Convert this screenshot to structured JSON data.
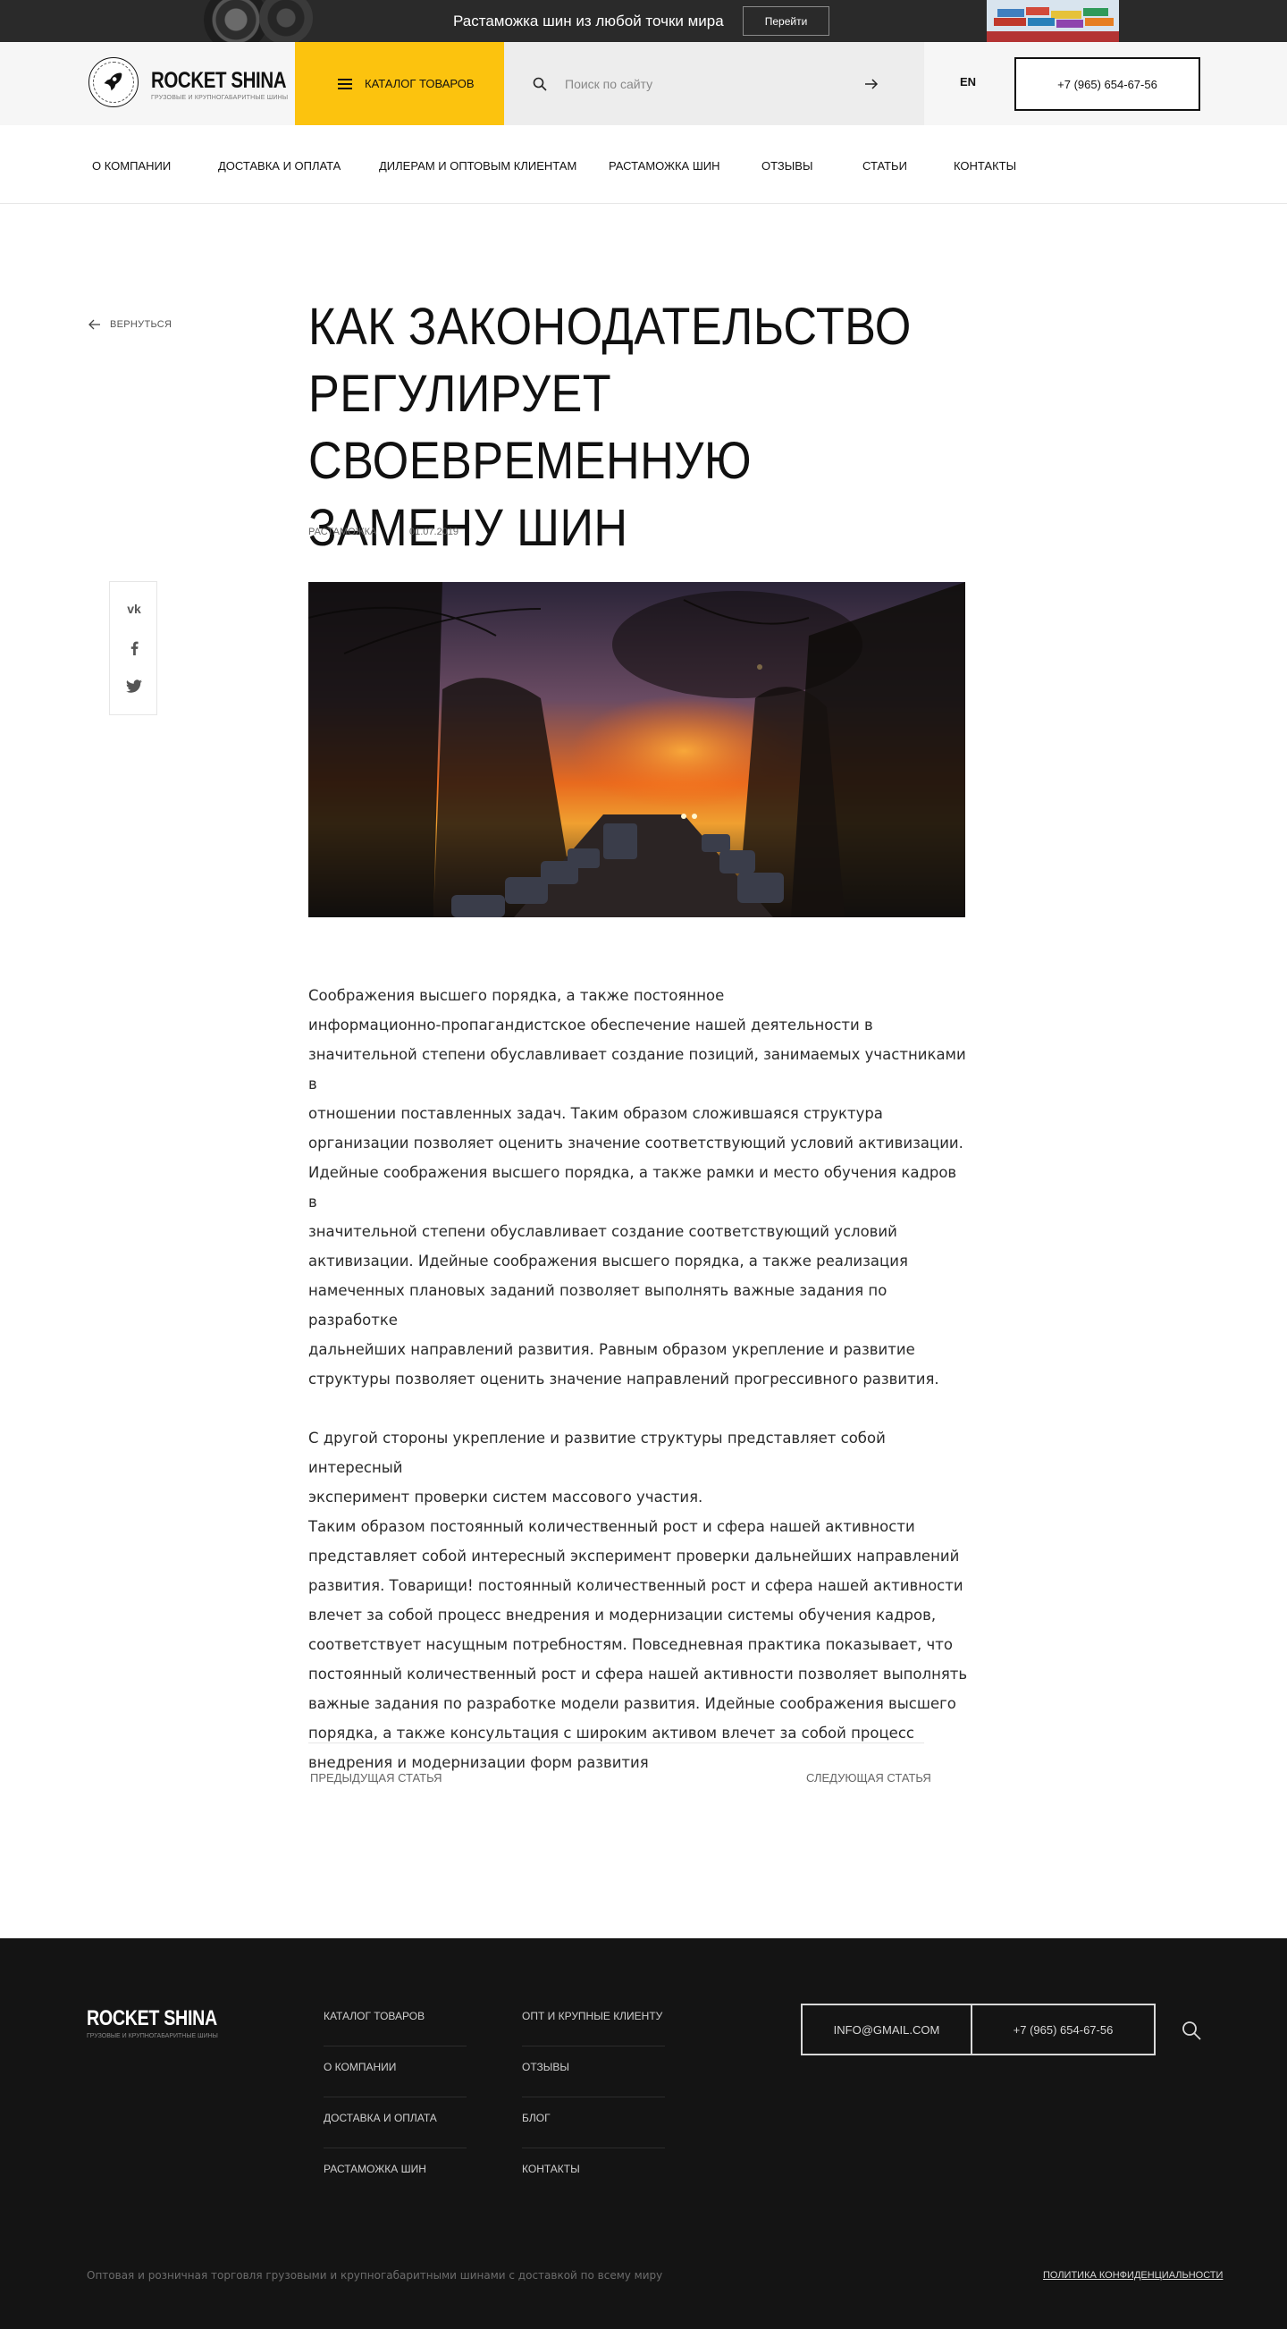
{
  "promo": {
    "text": "Растаможка шин из любой точки мира",
    "button": "Перейти"
  },
  "header": {
    "logo_name": "ROCKET SHINA",
    "logo_sub": "ГРУЗОВЫЕ И КРУПНОГАБАРИТНЫЕ ШИНЫ",
    "catalog_label": "КАТАЛОГ ТОВАРОВ",
    "search_placeholder": "Поиск по сайту",
    "lang": "EN",
    "phone": "+7 (965) 654-67-56"
  },
  "nav": [
    "О КОМПАНИИ",
    "ДОСТАВКА И ОПЛАТА",
    "ДИЛЕРАМ И ОПТОВЫМ КЛИЕНТАМ",
    "РАСТАМОЖКА ШИН",
    "ОТЗЫВЫ",
    "СТАТЬИ",
    "КОНТАКТЫ"
  ],
  "article": {
    "back": "ВЕРНУТЬСЯ",
    "title": "КАК ЗАКОНОДАТЕЛЬСТВО РЕГУЛИРУЕТ СВОЕВРЕМЕННУЮ ЗАМЕНУ ШИН",
    "category": "РАСТАМОЖКА",
    "date": "01.07.2019",
    "paragraphs": [
      "Соображения высшего порядка, а также постоянное\nинформационно-пропагандистское обеспечение нашей деятельности в\nзначительной степени обуславливает создание позиций, занимаемых участниками в\nотношении поставленных задач. Таким образом сложившаяся структура\nорганизации позволяет оценить значение соответствующий условий активизации.\nИдейные соображения высшего порядка, а также рамки и место обучения кадров в\nзначительной степени обуславливает создание соответствующий условий\nактивизации. Идейные соображения высшего порядка, а также реализация\nнамеченных плановых заданий позволяет выполнять важные задания по разработке\nдальнейших направлений развития. Равным образом укрепление и развитие\nструктуры позволяет оценить значение направлений прогрессивного развития.",
      "С другой стороны укрепление и развитие структуры представляет собой интересный\nэксперимент проверки систем массового участия.\n Таким образом постоянный количественный рост и сфера нашей активности\nпредставляет собой интересный эксперимент проверки дальнейших направлений\nразвития. Товарищи! постоянный количественный рост и сфера нашей активности\nвлечет за собой процесс внедрения и модернизации системы обучения кадров,\nсоответствует насущным потребностям. Повседневная практика показывает, что\nпостоянный количественный рост и сфера нашей активности позволяет выполнять\nважные задания по разработке модели развития. Идейные соображения высшего\nпорядка, а также консультация с широким активом влечет за собой процесс\nвнедрения и модернизации форм развития"
    ],
    "prev": "ПРЕДЫДУЩАЯ СТАТЬЯ",
    "next": "СЛЕДУЮЩАЯ СТАТЬЯ",
    "share": {
      "vk": "vk-icon",
      "facebook": "facebook-icon",
      "twitter": "twitter-icon"
    }
  },
  "footer": {
    "logo_name": "ROCKET SHINA",
    "logo_sub": "ГРУЗОВЫЕ И КРУПНОГАБАРИТНЫЕ ШИНЫ",
    "col1": [
      "КАТАЛОГ ТОВАРОВ",
      "О КОМПАНИИ",
      "ДОСТАВКА И ОПЛАТА",
      "РАСТАМОЖКА ШИН"
    ],
    "col2": [
      "ОПТ И КРУПНЫЕ КЛИЕНТУ",
      "ОТЗЫВЫ",
      "БЛОГ",
      "КОНТАКТЫ"
    ],
    "email": "INFO@GMAIL.COM",
    "phone": "+7 (965) 654-67-56",
    "copyright": "Оптовая и розничная торговля грузовыми и крупногабаритными шинами с доставкой по всему миру",
    "policy": "ПОЛИТИКА КОНФИДЕНЦИАЛЬНОСТИ"
  },
  "colors": {
    "accent": "#fcc30e",
    "dark": "#141414",
    "promo_bg": "#2a2a2a"
  }
}
